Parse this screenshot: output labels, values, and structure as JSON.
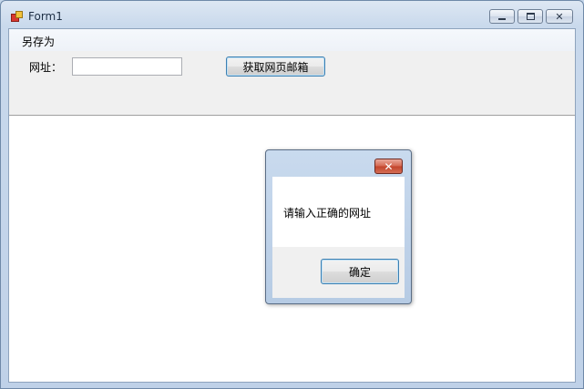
{
  "window": {
    "title": "Form1",
    "controls": {
      "minimize": "minimize",
      "maximize": "maximize",
      "close": "close"
    }
  },
  "menu": {
    "items": [
      {
        "label": "另存为"
      }
    ]
  },
  "form": {
    "url_label": "网址：",
    "url_value": "",
    "fetch_button": "获取网页邮箱"
  },
  "dialog": {
    "message": "请输入正确的网址",
    "ok_button": "确定",
    "close_glyph": "✕"
  },
  "icons": {
    "app": "winforms-app-icon",
    "minimize": "minimize-icon",
    "maximize": "maximize-icon",
    "close": "close-icon"
  },
  "colors": {
    "titlebar": "#c9d9ec",
    "client_bg": "#ffffff",
    "panel_bg": "#f0f0f0",
    "close_button": "#c2432a",
    "focus_border": "#3c7fb1"
  }
}
